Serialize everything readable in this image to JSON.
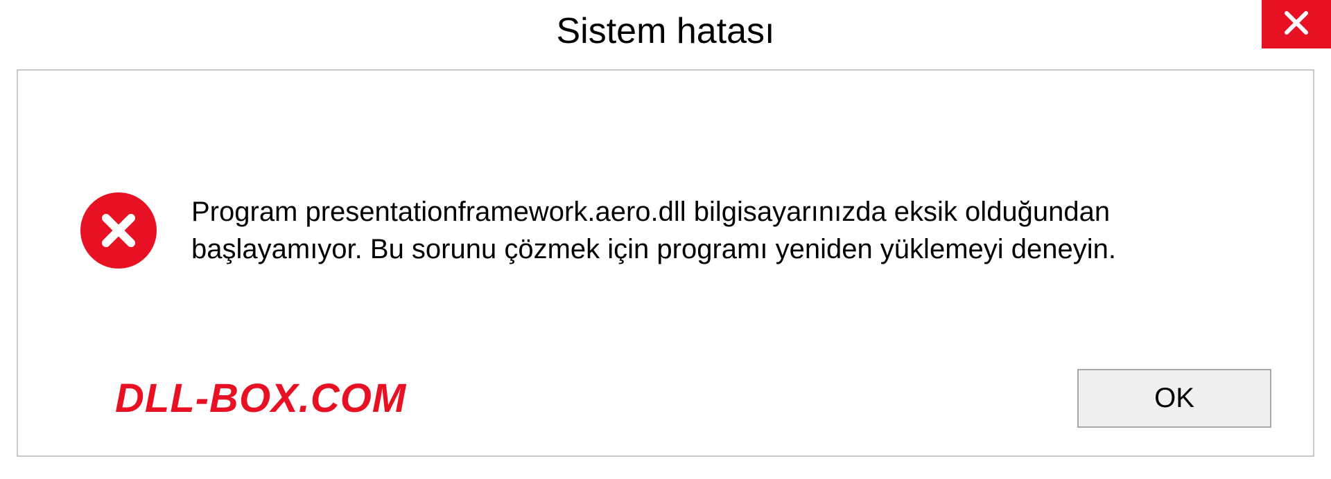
{
  "dialog": {
    "title": "Sistem hatası",
    "message": "Program presentationframework.aero.dll bilgisayarınızda eksik olduğundan başlayamıyor. Bu sorunu çözmek için programı yeniden yüklemeyi deneyin.",
    "ok_label": "OK"
  },
  "watermark": {
    "text": "DLL-BOX.COM"
  },
  "colors": {
    "error_red": "#e81123",
    "border_gray": "#c8c8c8"
  }
}
